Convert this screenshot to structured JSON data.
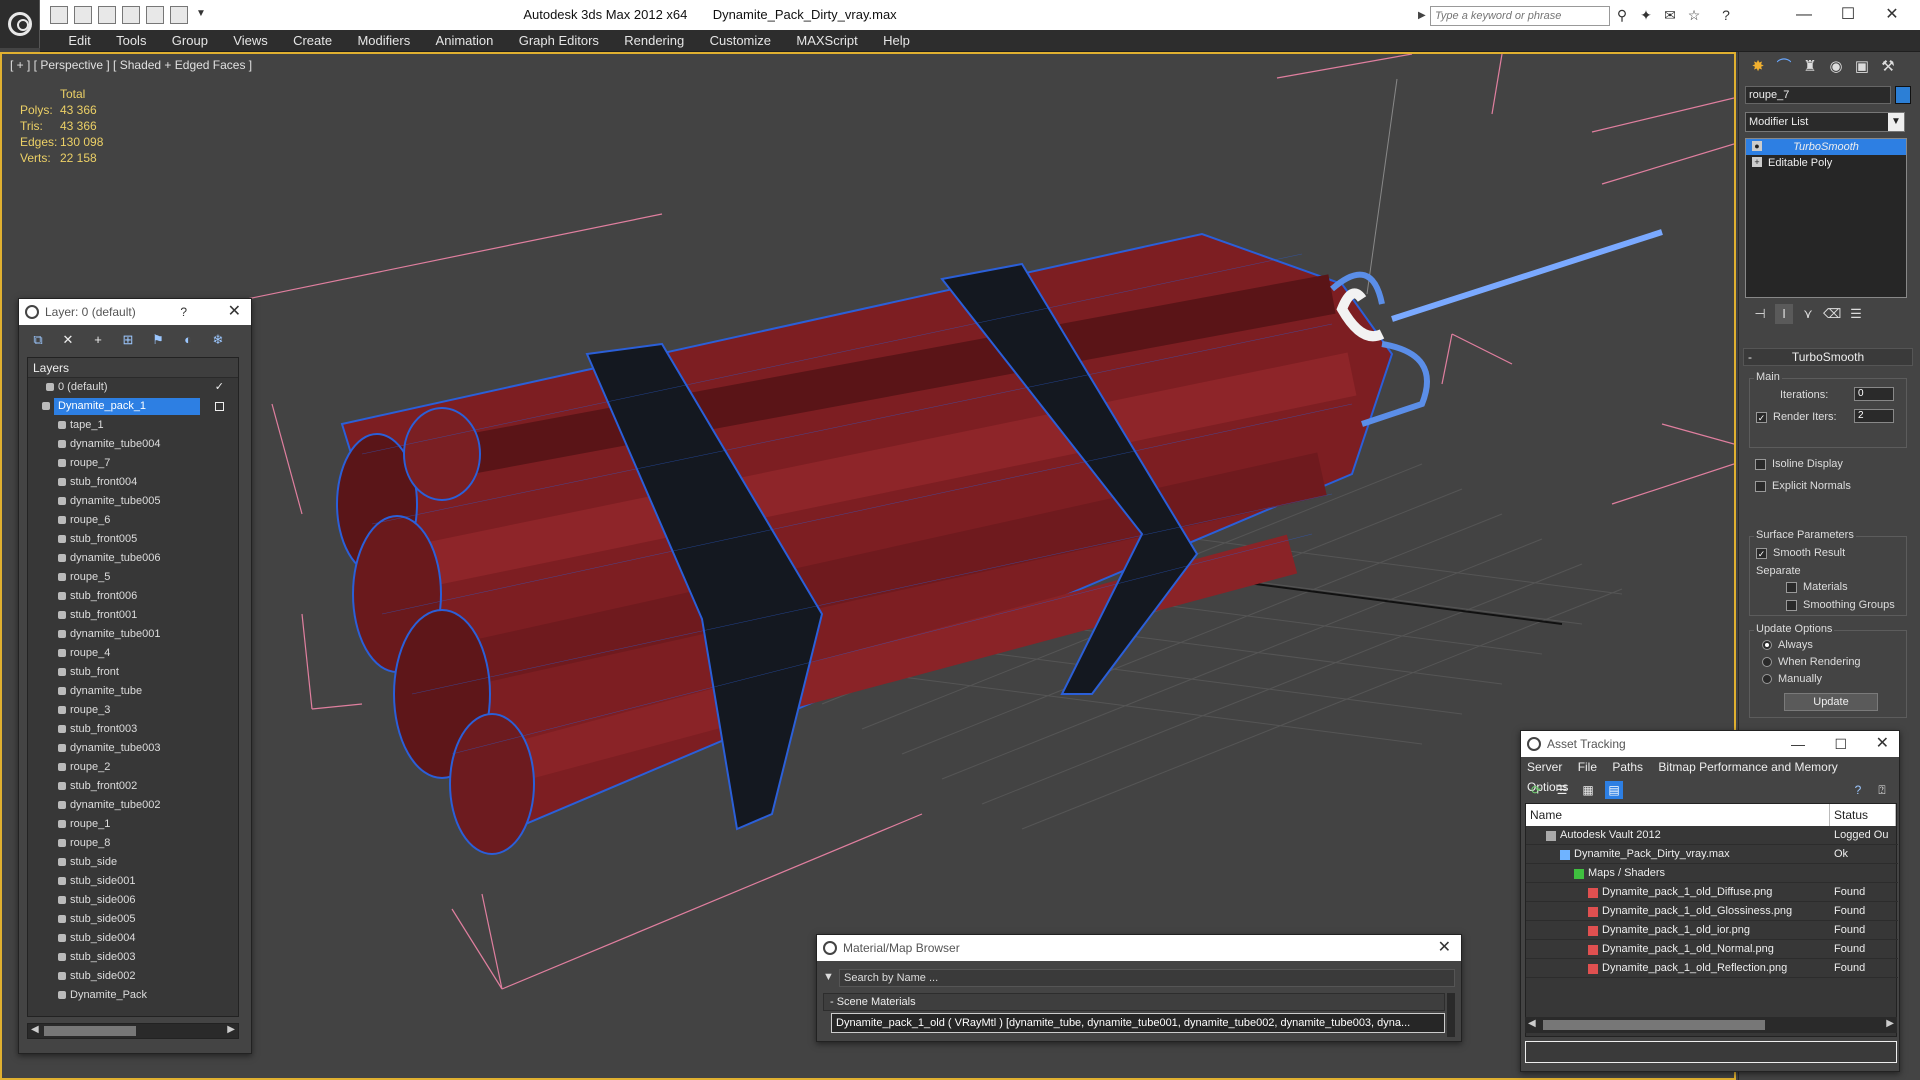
{
  "app": {
    "title": "Autodesk 3ds Max  2012 x64",
    "filename": "Dynamite_Pack_Dirty_vray.max",
    "search_placeholder": "Type a keyword or phrase"
  },
  "menu": [
    "Edit",
    "Tools",
    "Group",
    "Views",
    "Create",
    "Modifiers",
    "Animation",
    "Graph Editors",
    "Rendering",
    "Customize",
    "MAXScript",
    "Help"
  ],
  "viewport": {
    "label": "[ + ] [ Perspective ] [ Shaded + Edged Faces ]",
    "stats": {
      "header": "Total",
      "rows": [
        {
          "k": "Polys:",
          "v": "43 366"
        },
        {
          "k": "Tris:",
          "v": "43 366"
        },
        {
          "k": "Edges:",
          "v": "130 098"
        },
        {
          "k": "Verts:",
          "v": "22 158"
        }
      ]
    }
  },
  "command_panel": {
    "object_name": "roupe_7",
    "object_color": "#2c7fd6",
    "modifier_list": "Modifier List",
    "stack": [
      "TurboSmooth",
      "Editable Poly"
    ],
    "rollout": "TurboSmooth",
    "main_group": "Main",
    "iterations_label": "Iterations:",
    "iterations": "0",
    "render_iters_label": "Render Iters:",
    "render_iters": "2",
    "isoline": "Isoline Display",
    "explicit_normals": "Explicit Normals",
    "surface_group": "Surface Parameters",
    "smooth_result": "Smooth Result",
    "separate": "Separate",
    "materials": "Materials",
    "smoothing_groups": "Smoothing Groups",
    "update_group": "Update Options",
    "always": "Always",
    "when_rendering": "When Rendering",
    "manually": "Manually",
    "update_button": "Update"
  },
  "layer_dialog": {
    "title": "Layer: 0 (default)",
    "help": "?",
    "header": "Layers",
    "default_layer": "0 (default)",
    "selected_layer": "Dynamite_pack_1",
    "objects": [
      "tape_1",
      "dynamite_tube004",
      "roupe_7",
      "stub_front004",
      "dynamite_tube005",
      "roupe_6",
      "stub_front005",
      "dynamite_tube006",
      "roupe_5",
      "stub_front006",
      "stub_front001",
      "dynamite_tube001",
      "roupe_4",
      "stub_front",
      "dynamite_tube",
      "roupe_3",
      "stub_front003",
      "dynamite_tube003",
      "roupe_2",
      "stub_front002",
      "dynamite_tube002",
      "roupe_1",
      "roupe_8",
      "stub_side",
      "stub_side001",
      "stub_side006",
      "stub_side005",
      "stub_side004",
      "stub_side003",
      "stub_side002",
      "Dynamite_Pack"
    ]
  },
  "asset_tracking": {
    "title": "Asset Tracking",
    "menu": [
      "Server",
      "File",
      "Paths",
      "Bitmap Performance and Memory",
      "Options"
    ],
    "col_name": "Name",
    "col_status": "Status",
    "rows": [
      {
        "name": "Autodesk Vault 2012",
        "status": "Logged Ou"
      },
      {
        "name": "Dynamite_Pack_Dirty_vray.max",
        "status": "Ok"
      },
      {
        "name": "Maps / Shaders",
        "status": ""
      },
      {
        "name": "Dynamite_pack_1_old_Diffuse.png",
        "status": "Found"
      },
      {
        "name": "Dynamite_pack_1_old_Glossiness.png",
        "status": "Found"
      },
      {
        "name": "Dynamite_pack_1_old_ior.png",
        "status": "Found"
      },
      {
        "name": "Dynamite_pack_1_old_Normal.png",
        "status": "Found"
      },
      {
        "name": "Dynamite_pack_1_old_Reflection.png",
        "status": "Found"
      }
    ]
  },
  "material_browser": {
    "title": "Material/Map Browser",
    "search": "Search by Name ...",
    "section": "- Scene Materials",
    "item": "Dynamite_pack_1_old  ( VRayMtl ) [dynamite_tube, dynamite_tube001, dynamite_tube002, dynamite_tube003, dyna..."
  }
}
